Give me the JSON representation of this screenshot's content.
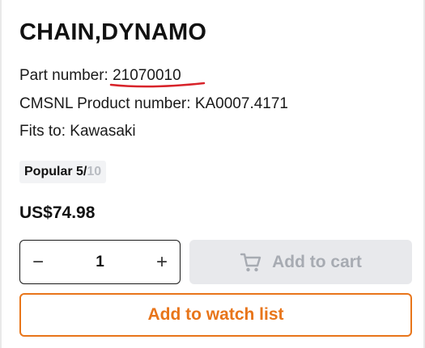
{
  "product": {
    "title": "CHAIN,DYNAMO",
    "part_number_label": "Part number: ",
    "part_number_value": "21070010",
    "cmsnl_label": "CMSNL Product number: ",
    "cmsnl_value": "KA0007.4171",
    "fits_label": "Fits to: ",
    "fits_value": "Kawasaki",
    "popular_label": "Popular ",
    "popular_score": "5/",
    "popular_max": "10",
    "price": "US$74.98"
  },
  "cart": {
    "decrement": "−",
    "quantity": "1",
    "increment": "+",
    "add_to_cart_label": "Add to cart",
    "watch_list_label": "Add to watch list"
  },
  "colors": {
    "accent_orange": "#e8751a",
    "annotation_red": "#d8232a",
    "disabled_bg": "#e8e9ec",
    "disabled_text": "#a7abb2"
  }
}
